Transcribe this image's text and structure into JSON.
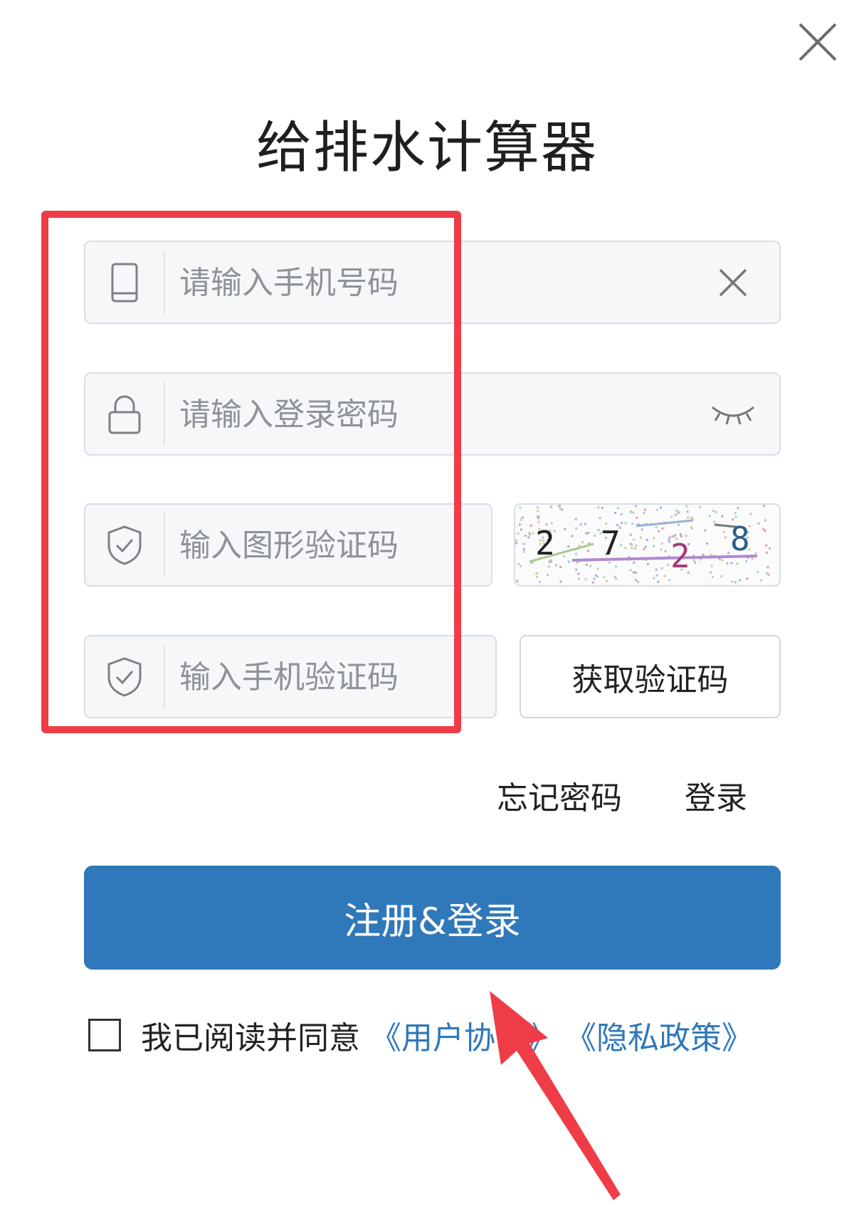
{
  "dialog": {
    "title": "给排水计算器"
  },
  "form": {
    "phone": {
      "placeholder": "请输入手机号码",
      "icon": "phone-icon",
      "clear_icon": "clear-icon"
    },
    "password": {
      "placeholder": "请输入登录密码",
      "icon": "lock-icon",
      "toggle_icon": "eye-closed-icon"
    },
    "image_captcha": {
      "placeholder": "输入图形验证码",
      "icon": "shield-check-icon",
      "captcha_text": "2728"
    },
    "sms_code": {
      "placeholder": "输入手机验证码",
      "icon": "shield-check-icon",
      "button_label": "获取验证码"
    }
  },
  "links": {
    "forgot_password": "忘记密码",
    "login": "登录"
  },
  "submit": {
    "label": "注册&登录"
  },
  "agreement": {
    "prefix": "我已阅读并同意",
    "user_agreement": "《用户协议》",
    "privacy_policy": "《隐私政策》"
  },
  "annotations": {
    "highlight_color": "#ef3d47"
  },
  "colors": {
    "primary": "#2f78ba",
    "field_bg": "#f6f7f9",
    "field_border": "#d8dde6"
  }
}
